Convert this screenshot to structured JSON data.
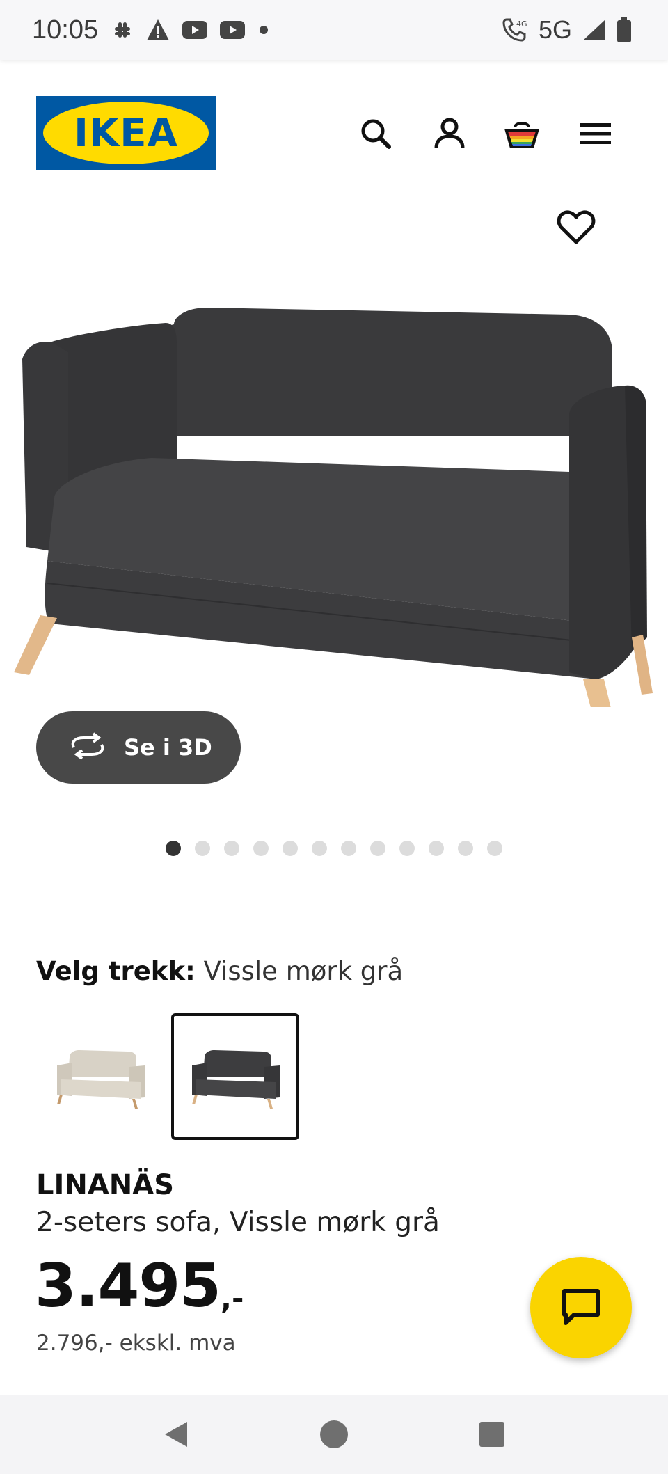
{
  "status_bar": {
    "time": "10:05",
    "network": "5G",
    "left_icons": [
      "slack-icon",
      "warning-icon",
      "youtube-icon",
      "youtube-icon",
      "dot-icon"
    ],
    "right_icons": [
      "wifi-call-icon",
      "signal-icon",
      "battery-icon"
    ]
  },
  "header": {
    "logo_text": "IKEA",
    "icons": [
      "search-icon",
      "account-icon",
      "basket-icon",
      "menu-icon"
    ]
  },
  "gallery": {
    "view_3d_label": "Se i 3D",
    "dot_count": 12,
    "active_dot": 0
  },
  "cover": {
    "label_key": "Velg trekk:",
    "label_value": "Vissle mørk grå",
    "options": [
      {
        "name": "beige",
        "selected": false
      },
      {
        "name": "dark-grey",
        "selected": true
      }
    ]
  },
  "product": {
    "name": "LINANÄS",
    "description": "2-seters sofa, Vissle mørk grå",
    "price_main": "3.495",
    "price_suffix": ",-",
    "price_ex_vat": "2.796,- ekskl. mva"
  },
  "colors": {
    "ikea_blue": "#0058a3",
    "ikea_yellow": "#ffdb00",
    "chat_yellow": "#fad400",
    "button_dark": "#484848"
  }
}
